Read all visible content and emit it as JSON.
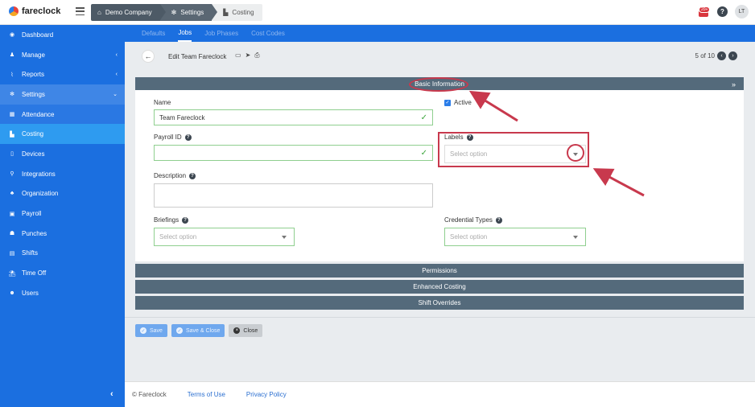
{
  "brand": {
    "name": "fareclock"
  },
  "breadcrumbs": [
    "Demo Company",
    "Settings",
    "Costing"
  ],
  "notifications": {
    "badge": "20+"
  },
  "user": {
    "initials": "LT"
  },
  "sidebar": {
    "items": [
      {
        "label": "Dashboard",
        "icon": "dashboard-icon"
      },
      {
        "label": "Manage",
        "icon": "user-icon",
        "chevron": "‹"
      },
      {
        "label": "Reports",
        "icon": "chart-icon",
        "chevron": "‹"
      },
      {
        "label": "Settings",
        "icon": "gear-icon",
        "chevron": "⌄"
      },
      {
        "label": "Attendance",
        "icon": "attendance-icon"
      },
      {
        "label": "Costing",
        "icon": "costing-icon"
      },
      {
        "label": "Devices",
        "icon": "device-icon"
      },
      {
        "label": "Integrations",
        "icon": "plug-icon"
      },
      {
        "label": "Organization",
        "icon": "org-icon"
      },
      {
        "label": "Payroll",
        "icon": "payroll-icon"
      },
      {
        "label": "Punches",
        "icon": "punch-icon"
      },
      {
        "label": "Shifts",
        "icon": "shift-icon"
      },
      {
        "label": "Time Off",
        "icon": "timeoff-icon"
      },
      {
        "label": "Users",
        "icon": "users-icon"
      }
    ],
    "collapse": "‹"
  },
  "subnav": {
    "tabs": [
      "Defaults",
      "Jobs",
      "Job Phases",
      "Cost Codes"
    ],
    "active": "Jobs"
  },
  "toolbar": {
    "title": "Edit Team Fareclock",
    "pager": "5 of 10"
  },
  "sections": {
    "basic": "Basic Information",
    "permissions": "Permissions",
    "enhanced": "Enhanced Costing",
    "overrides": "Shift Overrides"
  },
  "form": {
    "name_label": "Name",
    "name_value": "Team Fareclock",
    "active_label": "Active",
    "payroll_label": "Payroll ID",
    "payroll_value": "",
    "labels_label": "Labels",
    "labels_placeholder": "Select option",
    "description_label": "Description",
    "briefings_label": "Briefings",
    "briefings_placeholder": "Select option",
    "credential_label": "Credential Types",
    "credential_placeholder": "Select option"
  },
  "actions": {
    "save": "Save",
    "save_close": "Save & Close",
    "close": "Close"
  },
  "footer": {
    "copyright": "© Fareclock",
    "terms": "Terms of Use",
    "privacy": "Privacy Policy"
  },
  "colors": {
    "sidebar": "#1b6fe0",
    "section_header": "#546a7b",
    "annotation": "#c8394d"
  }
}
